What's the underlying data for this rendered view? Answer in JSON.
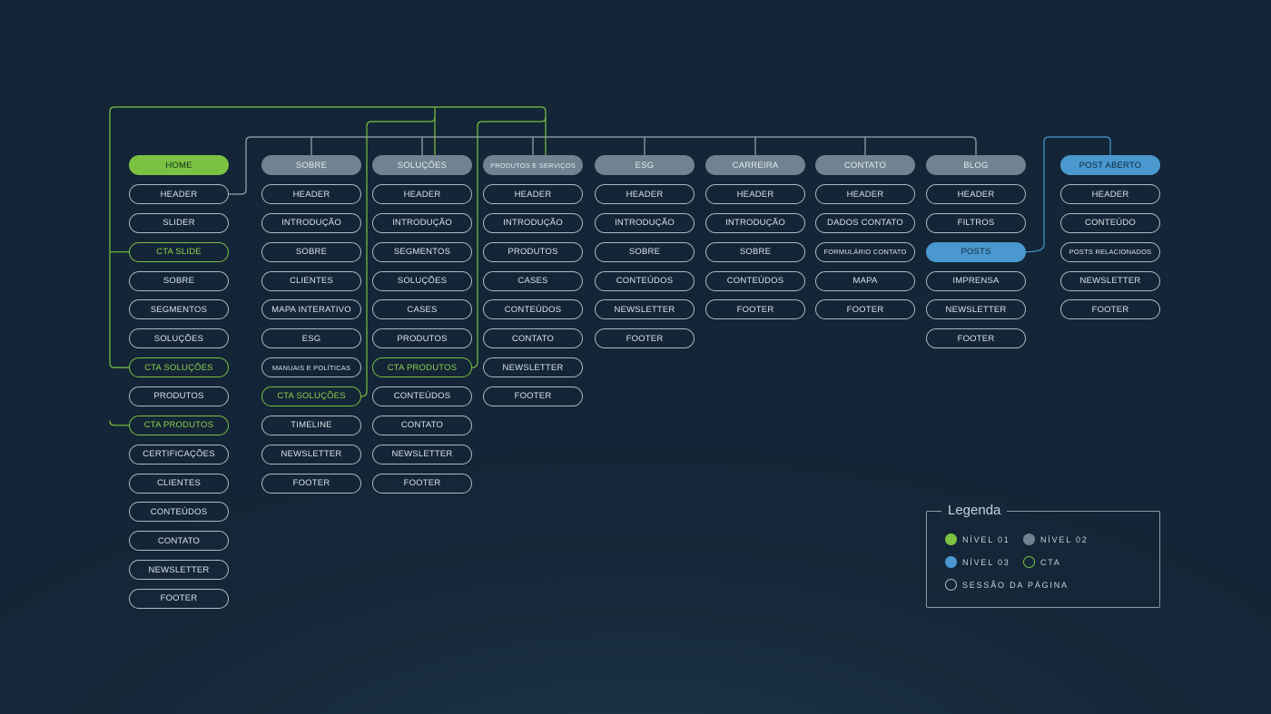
{
  "colors": {
    "level1": "#7cc242",
    "level2": "#6f8391",
    "level3": "#4a98cf",
    "cta": "#7cc242",
    "section": "#aebbc6",
    "cta_connector": "#7cc242",
    "nav_connector": "#9aa8b4",
    "level3_connector": "#4a98cf"
  },
  "columns": [
    {
      "header": {
        "label": "HOME",
        "level": 1
      },
      "items": [
        {
          "label": "HEADER",
          "type": "section"
        },
        {
          "label": "SLIDER",
          "type": "section"
        },
        {
          "label": "CTA SLIDE",
          "type": "cta"
        },
        {
          "label": "SOBRE",
          "type": "section"
        },
        {
          "label": "SEGMENTOS",
          "type": "section"
        },
        {
          "label": "SOLUÇÕES",
          "type": "section"
        },
        {
          "label": "CTA SOLUÇÕES",
          "type": "cta"
        },
        {
          "label": "PRODUTOS",
          "type": "section"
        },
        {
          "label": "CTA PRODUTOS",
          "type": "cta"
        },
        {
          "label": "CERTIFICAÇÕES",
          "type": "section"
        },
        {
          "label": "CLIENTES",
          "type": "section"
        },
        {
          "label": "CONTEÚDOS",
          "type": "section"
        },
        {
          "label": "CONTATO",
          "type": "section"
        },
        {
          "label": "NEWSLETTER",
          "type": "section"
        },
        {
          "label": "FOOTER",
          "type": "section"
        }
      ]
    },
    {
      "header": {
        "label": "SOBRE",
        "level": 2
      },
      "items": [
        {
          "label": "HEADER",
          "type": "section"
        },
        {
          "label": "INTRODUÇÃO",
          "type": "section"
        },
        {
          "label": "SOBRE",
          "type": "section"
        },
        {
          "label": "CLIENTES",
          "type": "section"
        },
        {
          "label": "MAPA INTERATIVO",
          "type": "section"
        },
        {
          "label": "ESG",
          "type": "section"
        },
        {
          "label": "MANUAIS E POLÍTICAS",
          "type": "section",
          "small": true
        },
        {
          "label": "CTA SOLUÇÕES",
          "type": "cta"
        },
        {
          "label": "TIMELINE",
          "type": "section"
        },
        {
          "label": "NEWSLETTER",
          "type": "section"
        },
        {
          "label": "FOOTER",
          "type": "section"
        }
      ]
    },
    {
      "header": {
        "label": "SOLUÇÕES",
        "level": 2
      },
      "items": [
        {
          "label": "HEADER",
          "type": "section"
        },
        {
          "label": "INTRODUÇÃO",
          "type": "section"
        },
        {
          "label": "SEGMENTOS",
          "type": "section"
        },
        {
          "label": "SOLUÇÕES",
          "type": "section"
        },
        {
          "label": "CASES",
          "type": "section"
        },
        {
          "label": "PRODUTOS",
          "type": "section"
        },
        {
          "label": "CTA PRODUTOS",
          "type": "cta"
        },
        {
          "label": "CONTEÚDOS",
          "type": "section"
        },
        {
          "label": "CONTATO",
          "type": "section"
        },
        {
          "label": "NEWSLETTER",
          "type": "section"
        },
        {
          "label": "FOOTER",
          "type": "section"
        }
      ]
    },
    {
      "header": {
        "label": "PRODUTOS E SERVIÇOS",
        "level": 2,
        "small": true
      },
      "items": [
        {
          "label": "HEADER",
          "type": "section"
        },
        {
          "label": "INTRODUÇÃO",
          "type": "section"
        },
        {
          "label": "PRODUTOS",
          "type": "section"
        },
        {
          "label": "CASES",
          "type": "section"
        },
        {
          "label": "CONTEÚDOS",
          "type": "section"
        },
        {
          "label": "CONTATO",
          "type": "section"
        },
        {
          "label": "NEWSLETTER",
          "type": "section"
        },
        {
          "label": "FOOTER",
          "type": "section"
        }
      ]
    },
    {
      "header": {
        "label": "ESG",
        "level": 2
      },
      "items": [
        {
          "label": "HEADER",
          "type": "section"
        },
        {
          "label": "INTRODUÇÃO",
          "type": "section"
        },
        {
          "label": "SOBRE",
          "type": "section"
        },
        {
          "label": "CONTEÚDOS",
          "type": "section"
        },
        {
          "label": "NEWSLETTER",
          "type": "section"
        },
        {
          "label": "FOOTER",
          "type": "section"
        }
      ]
    },
    {
      "header": {
        "label": "CARREIRA",
        "level": 2
      },
      "items": [
        {
          "label": "HEADER",
          "type": "section"
        },
        {
          "label": "INTRODUÇÃO",
          "type": "section"
        },
        {
          "label": "SOBRE",
          "type": "section"
        },
        {
          "label": "CONTEÚDOS",
          "type": "section"
        },
        {
          "label": "FOOTER",
          "type": "section"
        }
      ]
    },
    {
      "header": {
        "label": "CONTATO",
        "level": 2
      },
      "items": [
        {
          "label": "HEADER",
          "type": "section"
        },
        {
          "label": "DADOS CONTATO",
          "type": "section"
        },
        {
          "label": "FORMULÁRIO CONTATO",
          "type": "section",
          "small": true
        },
        {
          "label": "MAPA",
          "type": "section"
        },
        {
          "label": "FOOTER",
          "type": "section"
        }
      ]
    },
    {
      "header": {
        "label": "BLOG",
        "level": 2
      },
      "items": [
        {
          "label": "HEADER",
          "type": "section"
        },
        {
          "label": "FILTROS",
          "type": "section"
        },
        {
          "label": "POSTS",
          "type": "level3"
        },
        {
          "label": "IMPRENSA",
          "type": "section"
        },
        {
          "label": "NEWSLETTER",
          "type": "section"
        },
        {
          "label": "FOOTER",
          "type": "section"
        }
      ]
    },
    {
      "header": {
        "label": "POST ABERTO",
        "level": 3
      },
      "items": [
        {
          "label": "HEADER",
          "type": "section"
        },
        {
          "label": "CONTEÚDO",
          "type": "section"
        },
        {
          "label": "POSTS RELACIONADOS",
          "type": "section",
          "small": true
        },
        {
          "label": "NEWSLETTER",
          "type": "section"
        },
        {
          "label": "FOOTER",
          "type": "section"
        }
      ]
    }
  ],
  "legend": {
    "title": "Legenda",
    "items": [
      {
        "label": "NÍVEL 01",
        "kind": "level1"
      },
      {
        "label": "NÍVEL 02",
        "kind": "level2"
      },
      {
        "label": "NÍVEL 03",
        "kind": "level3"
      },
      {
        "label": "CTA",
        "kind": "cta"
      },
      {
        "label": "SESSÃO DA PÁGINA",
        "kind": "section"
      }
    ]
  }
}
